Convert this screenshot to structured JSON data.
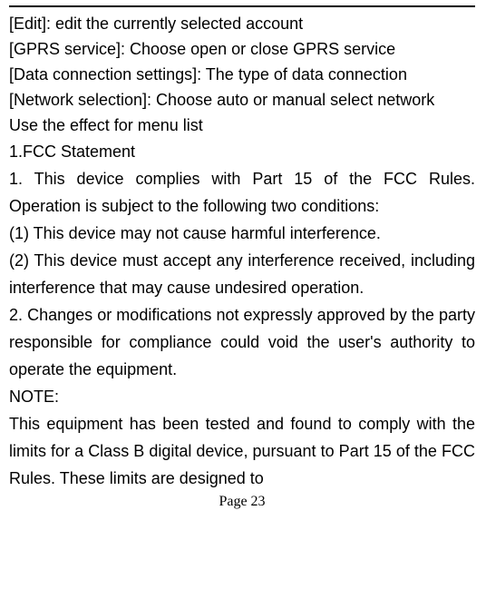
{
  "lines": {
    "edit": "[Edit]: edit the currently selected account",
    "gprs": "[GPRS service]: Choose open or close GPRS service",
    "data_conn": "[Data connection settings]: The type of data connection",
    "network_sel": "[Network selection]: Choose auto or manual select network",
    "use_effect": "Use the effect for menu list",
    "fcc_heading": "1.FCC Statement"
  },
  "body": {
    "p1": "1. This device complies with Part 15 of the FCC Rules. Operation is subject to the following two conditions:",
    "p2": "(1) This device may not cause harmful interference.",
    "p3": "(2) This device must accept any interference received, including interference that may cause undesired operation.",
    "p4": "2. Changes or modifications not expressly approved by the party responsible for compliance could void the user's authority to operate the equipment.",
    "note": "NOTE:",
    "p5": "This equipment has been tested and found to comply with the limits for a Class B digital device, pursuant to Part 15 of the FCC Rules. These limits are designed to"
  },
  "page_number": "Page 23"
}
